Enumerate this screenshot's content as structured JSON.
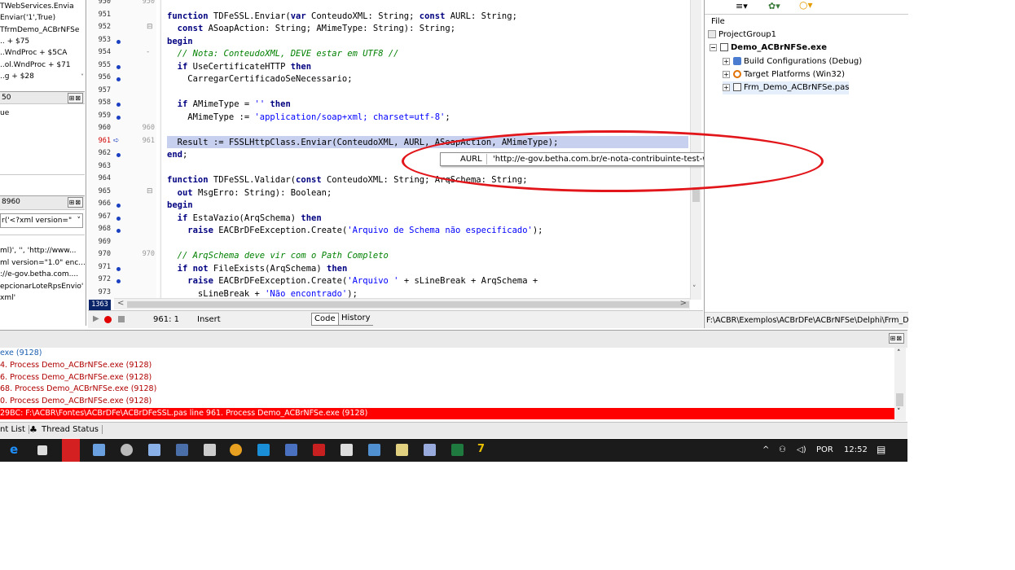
{
  "left_panel": {
    "call_stack": [
      "TWebServices.Envia",
      "Enviar('1',True)",
      "TfrmDemo_ACBrNFSe",
      ".. + $75",
      "..WndProc + $5CA",
      "..ol.WndProc + $71",
      "..g + $28"
    ],
    "watch_title": "50",
    "watch_value": "ue",
    "local_title": "8960",
    "local_combo": "r('<?xml version=\"",
    "local_lines": [
      "ml)', '', 'http://www...",
      "ml version=\"1.0\" enc...",
      "://e-gov.betha.com....",
      "epcionarLoteRpsEnvio'",
      "xml'"
    ]
  },
  "editor": {
    "lines": [
      {
        "n": "950",
        "n2": "950",
        "bp": false,
        "html": "",
        "fold": ""
      },
      {
        "n": "951",
        "n2": "",
        "bp": false,
        "fold": ""
      },
      {
        "n": "952",
        "n2": "",
        "bp": false,
        "fold": "⊟"
      },
      {
        "n": "953",
        "n2": "",
        "bp": true,
        "fold": ""
      },
      {
        "n": "954",
        "n2": "",
        "bp": false,
        "fold": "-"
      },
      {
        "n": "955",
        "n2": "",
        "bp": true,
        "fold": ""
      },
      {
        "n": "956",
        "n2": "",
        "bp": true,
        "fold": ""
      },
      {
        "n": "957",
        "n2": "",
        "bp": false,
        "fold": ""
      },
      {
        "n": "958",
        "n2": "",
        "bp": true,
        "fold": ""
      },
      {
        "n": "959",
        "n2": "",
        "bp": true,
        "fold": ""
      },
      {
        "n": "960",
        "n2": "960",
        "bp": false,
        "fold": ""
      },
      {
        "n": "961",
        "n2": "961",
        "bp": false,
        "fold": ""
      },
      {
        "n": "962",
        "n2": "",
        "bp": true,
        "fold": ""
      },
      {
        "n": "963",
        "n2": "",
        "bp": false,
        "fold": ""
      },
      {
        "n": "964",
        "n2": "",
        "bp": false,
        "fold": ""
      },
      {
        "n": "965",
        "n2": "",
        "bp": false,
        "fold": "⊟"
      },
      {
        "n": "966",
        "n2": "",
        "bp": true,
        "fold": ""
      },
      {
        "n": "967",
        "n2": "",
        "bp": true,
        "fold": ""
      },
      {
        "n": "968",
        "n2": "",
        "bp": true,
        "fold": ""
      },
      {
        "n": "969",
        "n2": "",
        "bp": false,
        "fold": ""
      },
      {
        "n": "970",
        "n2": "970",
        "bp": false,
        "fold": ""
      },
      {
        "n": "971",
        "n2": "",
        "bp": true,
        "fold": ""
      },
      {
        "n": "972",
        "n2": "",
        "bp": true,
        "fold": ""
      },
      {
        "n": "973",
        "n2": "",
        "bp": false,
        "fold": ""
      }
    ],
    "code": [
      "",
      "<span class=\"kw\">function</span> TDFeSSL.Enviar(<span class=\"kw\">var</span> ConteudoXML: String; <span class=\"kw\">const</span> AURL: String;",
      "  <span class=\"kw\">const</span> ASoapAction: String; AMimeType: String): String;",
      "<span class=\"kw\">begin</span>",
      "  <span class=\"cm\">// Nota: ConteudoXML, DEVE estar em UTF8 //</span>",
      "  <span class=\"kw\">if</span> UseCertificateHTTP <span class=\"kw\">then</span>",
      "    CarregarCertificadoSeNecessario;",
      "",
      "  <span class=\"kw\">if</span> AMimeType = <span class=\"st\">''</span> <span class=\"kw\">then</span>",
      "    AMimeType := <span class=\"st\">'application/soap+xml; charset=utf-8'</span>;",
      "",
      "  Result := FSSLHttpClass.Enviar(ConteudoXML, AURL, ASoapAction, AMimeType);",
      "<span class=\"kw\">end</span>;",
      "",
      "<span class=\"kw\">function</span> TDFeSSL.Validar(<span class=\"kw\">const</span> ConteudoXML: String; ArqSchema: String;",
      "  <span class=\"kw\">out</span> MsgErro: String): Boolean;",
      "<span class=\"kw\">begin</span>",
      "  <span class=\"kw\">if</span> EstaVazio(ArqSchema) <span class=\"kw\">then</span>",
      "    <span class=\"kw\">raise</span> EACBrDFeException.Create(<span class=\"st\">'Arquivo de Schema não especificado'</span>);",
      "",
      "  <span class=\"cm\">// ArqSchema deve vir com o Path Completo</span>",
      "  <span class=\"kw\">if not</span> FileExists(ArqSchema) <span class=\"kw\">then</span>",
      "    <span class=\"kw\">raise</span> EACBrDFeException.Create(<span class=\"st\">'Arquivo '</span> + sLineBreak + ArqSchema +",
      "      sLineBreak + <span class=\"st\">'Não encontrado'</span>);"
    ],
    "line_counter": "1363",
    "status_pos": "961:  1",
    "status_mode": "Insert",
    "tab_code": "Code",
    "tab_history": "History"
  },
  "tooltip": {
    "name": "AURL",
    "value": "'http://e-gov.betha.com.br/e-nota-contribuinte-test-ws/nfseWS?wsdl'"
  },
  "project": {
    "file_label": "File",
    "group": "ProjectGroup1",
    "exe": "Demo_ACBrNFSe.exe",
    "items": [
      "Build Configurations (Debug)",
      "Target Platforms (Win32)",
      "Frm_Demo_ACBrNFSe.pas"
    ],
    "path": "F:\\ACBR\\Exemplos\\ACBrDFe\\ACBrNFSe\\Delphi\\Frm_Dem"
  },
  "messages": {
    "lines": [
      "exe (9128)",
      "4. Process Demo_ACBrNFSe.exe (9128)",
      "6. Process Demo_ACBrNFSe.exe (9128)",
      "68. Process Demo_ACBrNFSe.exe (9128)",
      "0. Process Demo_ACBrNFSe.exe (9128)"
    ],
    "error": "29BC: F:\\ACBR\\Fontes\\ACBrDFe\\ACBrDFeSSL.pas line 961. Process Demo_ACBrNFSe.exe (9128)"
  },
  "bottom_tabs": [
    "nt List",
    "Thread Status"
  ],
  "taskbar": {
    "lang": "POR",
    "time": "12:52"
  },
  "colors": {
    "error_bg": "#ff0000",
    "highlight": "#c8d0f0",
    "circle": "#e2161a"
  }
}
